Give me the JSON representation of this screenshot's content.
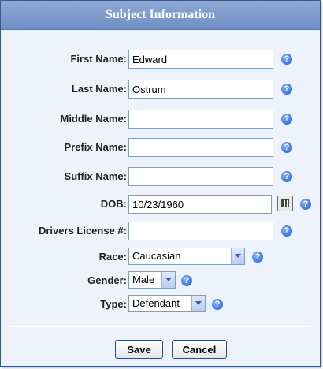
{
  "dialog": {
    "title": "Subject Information"
  },
  "fields": {
    "first_name": {
      "label": "First Name:",
      "value": "Edward"
    },
    "last_name": {
      "label": "Last Name:",
      "value": "Ostrum"
    },
    "middle_name": {
      "label": "Middle Name:",
      "value": ""
    },
    "prefix_name": {
      "label": "Prefix Name:",
      "value": ""
    },
    "suffix_name": {
      "label": "Suffix Name:",
      "value": ""
    },
    "dob": {
      "label": "DOB:",
      "value": "10/23/1960"
    },
    "drivers_license": {
      "label": "Drivers License #:",
      "value": ""
    },
    "race": {
      "label": "Race:",
      "value": "Caucasian"
    },
    "gender": {
      "label": "Gender:",
      "value": "Male"
    },
    "type": {
      "label": "Type:",
      "value": "Defendant"
    }
  },
  "help_glyph": "?",
  "buttons": {
    "save": "Save",
    "cancel": "Cancel"
  },
  "colors": {
    "title_bar": "#7f9ccc",
    "background": "#eef3fb",
    "help_icon": "#2457c8"
  }
}
